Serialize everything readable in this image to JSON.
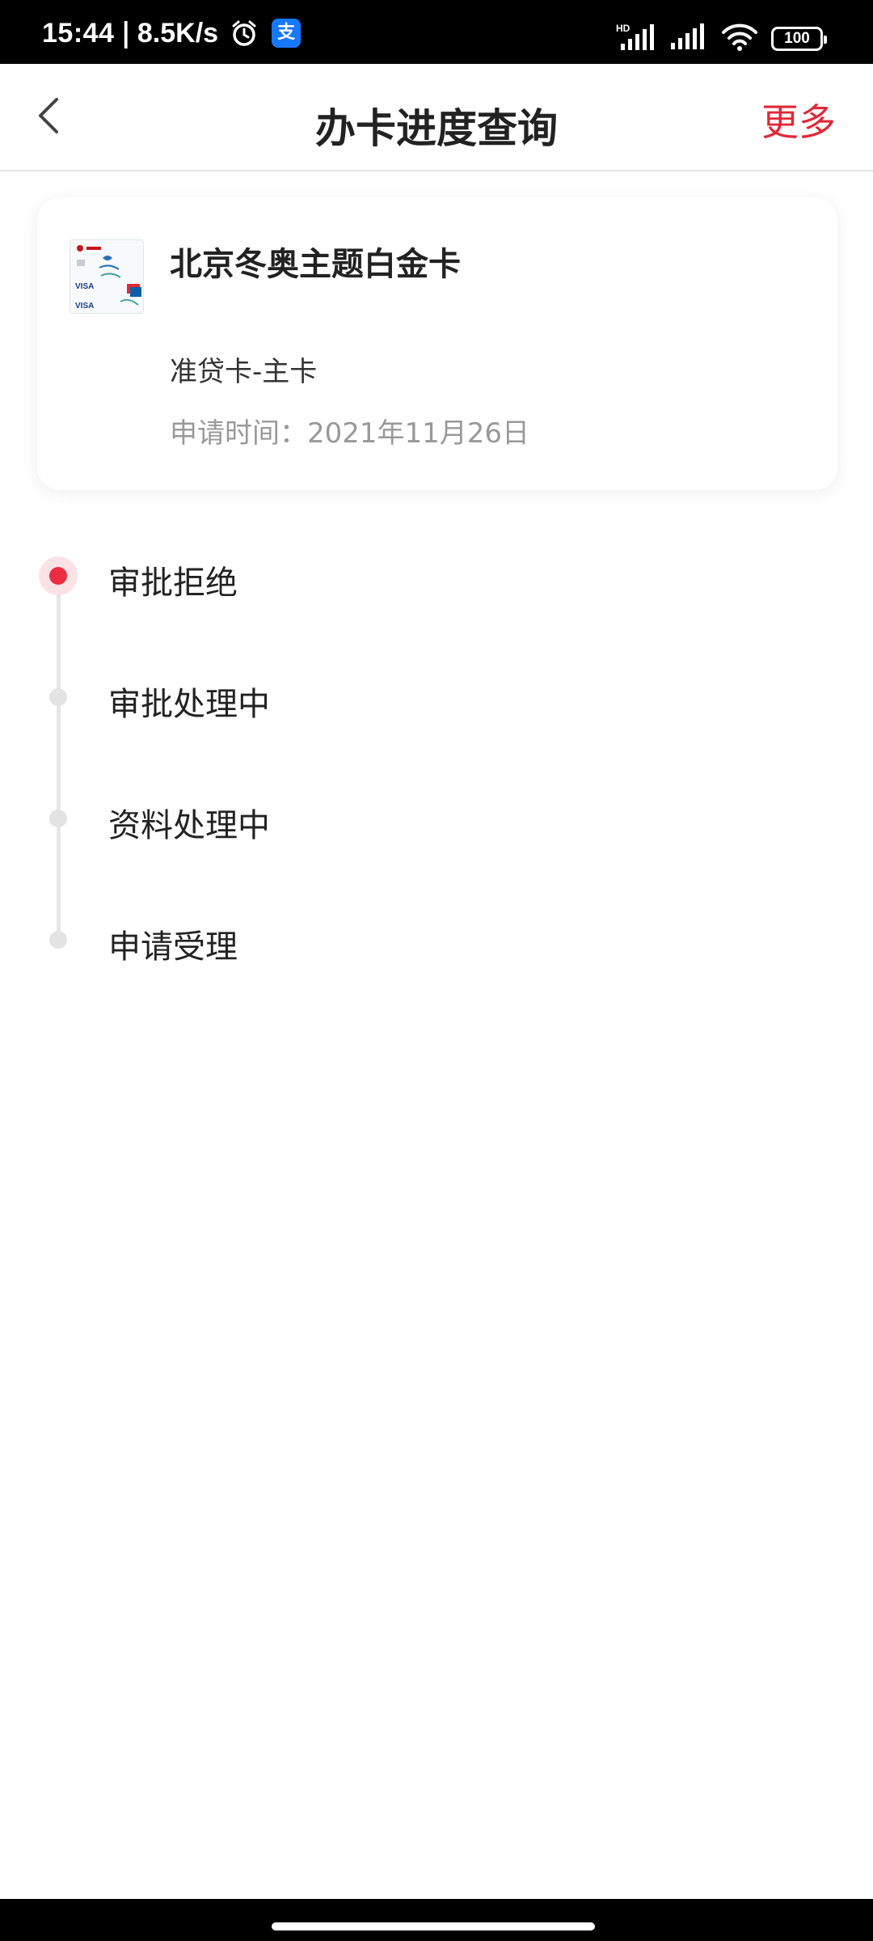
{
  "status_bar": {
    "time": "15:44",
    "separator": "|",
    "net_speed": "8.5K/s",
    "battery": "100",
    "icons": [
      "alarm-icon",
      "alipay-icon",
      "hd-signal-icon",
      "signal-icon",
      "wifi-icon",
      "battery-icon"
    ]
  },
  "header": {
    "title": "办卡进度查询",
    "more_label": "更多",
    "back_icon": "chevron-left-icon"
  },
  "card": {
    "name": "北京冬奥主题白金卡",
    "type": "准贷卡-主卡",
    "apply_date": "申请时间：2021年11月26日"
  },
  "timeline": {
    "steps": [
      {
        "label": "审批拒绝"
      },
      {
        "label": "审批处理中"
      },
      {
        "label": "资料处理中"
      },
      {
        "label": "申请受理"
      }
    ]
  },
  "colors": {
    "accent": "#e0293b",
    "active_dot": "#ec2c40",
    "inactive_dot": "#e3e3e3",
    "muted_text": "#999999"
  }
}
